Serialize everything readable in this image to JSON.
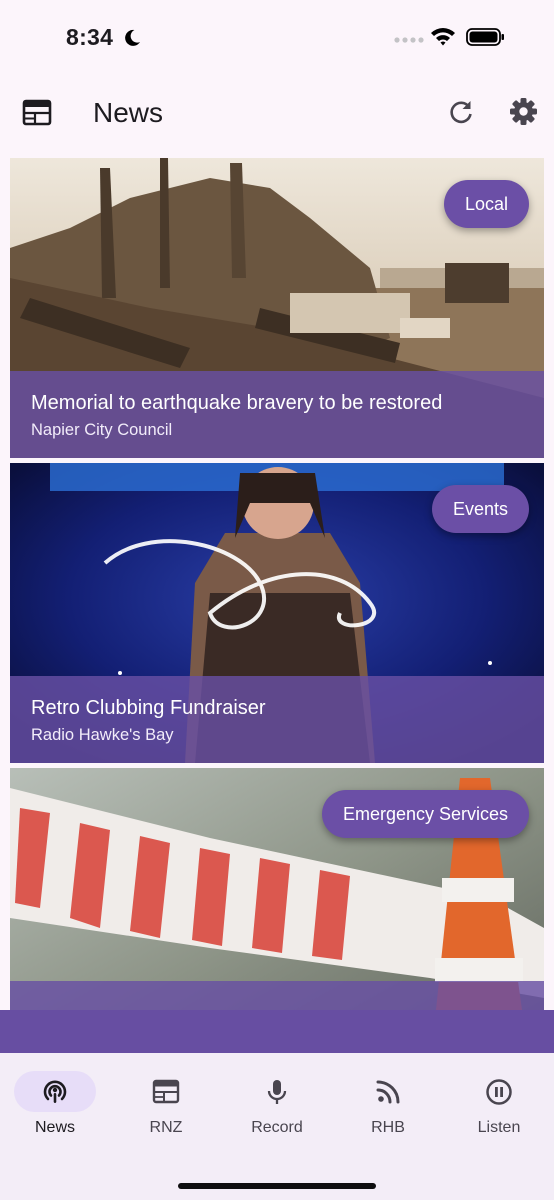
{
  "status_bar": {
    "time": "8:34",
    "icons": [
      "moon-icon",
      "signal-icon",
      "wifi-icon",
      "battery-icon"
    ]
  },
  "app_bar": {
    "title": "News",
    "leading_icon": "newspaper-icon",
    "actions": [
      "refresh-icon",
      "settings-icon"
    ]
  },
  "news": [
    {
      "title": "Memorial to earthquake bravery to be restored",
      "source": "Napier City Council",
      "category": "Local"
    },
    {
      "title": "Retro Clubbing Fundraiser",
      "source": "Radio Hawke's Bay",
      "category": "Events"
    },
    {
      "title": "",
      "source": "",
      "category": "Emergency Services"
    }
  ],
  "bottom_nav": {
    "active": "News",
    "items": [
      {
        "label": "News",
        "icon": "podcast-icon"
      },
      {
        "label": "RNZ",
        "icon": "newspaper-icon"
      },
      {
        "label": "Record",
        "icon": "microphone-icon"
      },
      {
        "label": "RHB",
        "icon": "rss-icon"
      },
      {
        "label": "Listen",
        "icon": "pause-circle-icon"
      }
    ]
  },
  "colors": {
    "accent": "#674ea2",
    "chip": "#6b4fa6",
    "background": "#fcf5fb",
    "nav_background": "#f3edf7",
    "nav_active_pill": "#e7ddf8"
  }
}
